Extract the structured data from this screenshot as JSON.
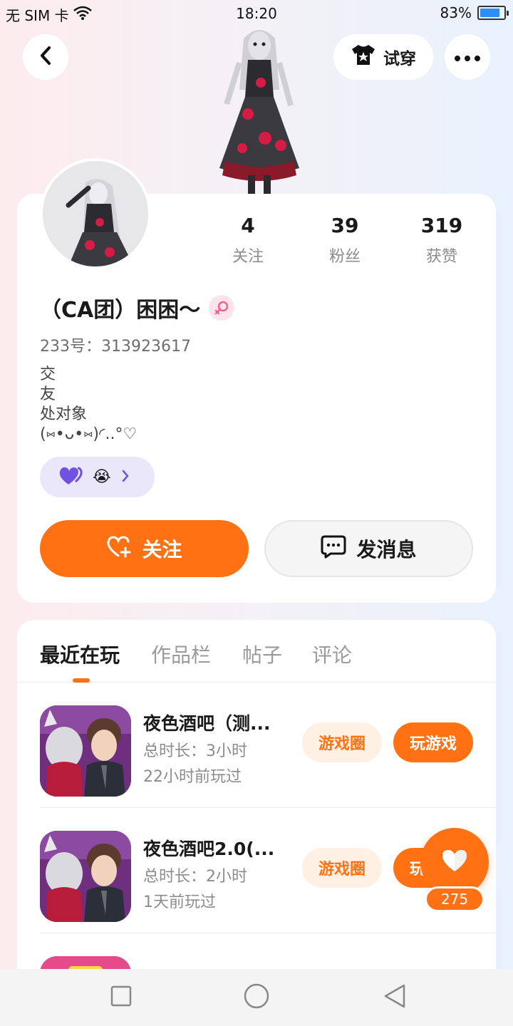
{
  "status_bar": {
    "carrier": "无 SIM 卡",
    "time": "18:20",
    "battery_percent": "83%",
    "battery_level": 0.83
  },
  "header": {
    "tryon_label": "试穿"
  },
  "profile": {
    "stats": [
      {
        "value": "4",
        "label": "关注"
      },
      {
        "value": "39",
        "label": "粉丝"
      },
      {
        "value": "319",
        "label": "获赞"
      }
    ],
    "nickname": "（CA团）困困～",
    "account_id": "233号：313923617",
    "bio_lines": [
      "交",
      "友",
      "处对象",
      "(⑅•ᴗ•⑅)◜..°♡"
    ],
    "tag_emoji": "😭",
    "follow_label": "关注",
    "message_label": "发消息"
  },
  "tabs": [
    {
      "label": "最近在玩",
      "active": true
    },
    {
      "label": "作品栏",
      "active": false
    },
    {
      "label": "帖子",
      "active": false
    },
    {
      "label": "评论",
      "active": false
    }
  ],
  "games": [
    {
      "title": "夜色酒吧（测...",
      "duration": "总时长：3小时",
      "last_played": "22小时前玩过",
      "circle_label": "游戏圈",
      "play_label": "玩游戏"
    },
    {
      "title": "夜色酒吧2.0(...",
      "duration": "总时长：2小时",
      "last_played": "1天前玩过",
      "circle_label": "游戏圈",
      "play_label": "玩游戏"
    }
  ],
  "floating_like": {
    "count": "275"
  },
  "colors": {
    "accent": "#ff7113",
    "accent_soft": "#fff0e4",
    "tag_bg": "#ebe7fb",
    "gender_pink": "#f06292"
  }
}
